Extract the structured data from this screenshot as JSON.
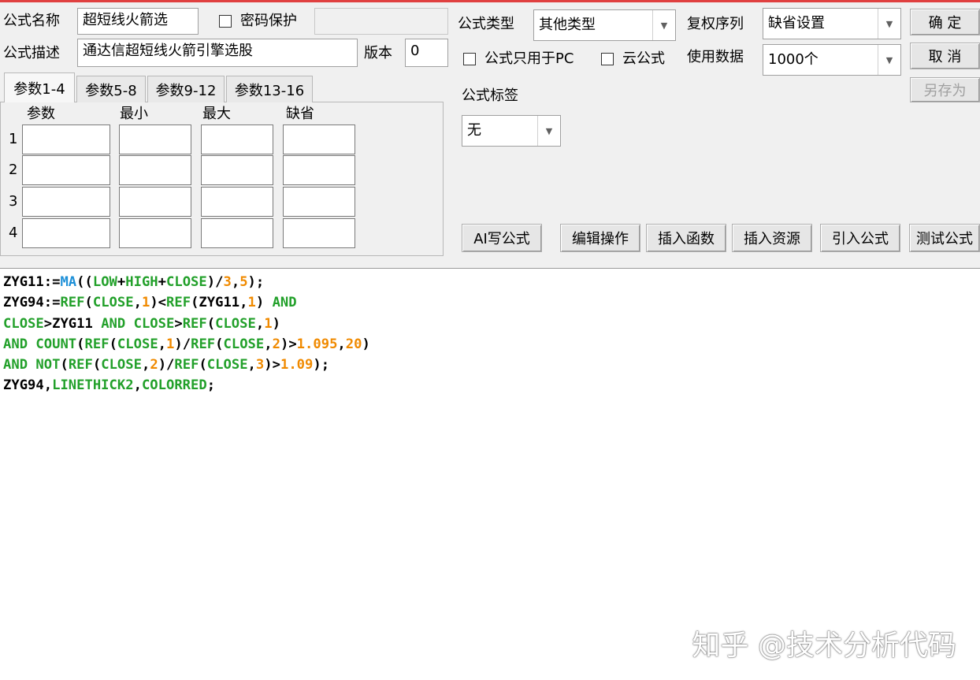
{
  "form": {
    "name_label": "公式名称",
    "name_value": "超短线火箭选",
    "password_label": "密码保护",
    "desc_label": "公式描述",
    "desc_value": "通达信超短线火箭引擎选股",
    "version_label": "版本",
    "version_value": "0"
  },
  "options": {
    "type_label": "公式类型",
    "type_value": "其他类型",
    "restore_label": "复权序列",
    "restore_value": "缺省设置",
    "pc_only_label": "公式只用于PC",
    "cloud_label": "云公式",
    "usedata_label": "使用数据",
    "usedata_value": "1000个",
    "tag_label": "公式标签",
    "tag_value": "无"
  },
  "buttons": {
    "ok": "确  定",
    "cancel": "取  消",
    "saveas": "另存为",
    "ai": "AI写公式",
    "edit": "编辑操作",
    "insert_func": "插入函数",
    "insert_res": "插入资源",
    "import": "引入公式",
    "test": "测试公式"
  },
  "params": {
    "tabs": [
      "参数1-4",
      "参数5-8",
      "参数9-12",
      "参数13-16"
    ],
    "headers": [
      "参数",
      "最小",
      "最大",
      "缺省"
    ],
    "rows": [
      "1",
      "2",
      "3",
      "4"
    ]
  },
  "code": {
    "lines": [
      [
        [
          "ZYG11:=",
          "k"
        ],
        [
          "MA",
          "m"
        ],
        [
          "((",
          "k"
        ],
        [
          "LOW",
          "f"
        ],
        [
          "+",
          "k"
        ],
        [
          "HIGH",
          "f"
        ],
        [
          "+",
          "k"
        ],
        [
          "CLOSE",
          "f"
        ],
        [
          ")/",
          "k"
        ],
        [
          "3",
          "n"
        ],
        [
          ",",
          "k"
        ],
        [
          "5",
          "n"
        ],
        [
          ");",
          "k"
        ]
      ],
      [
        [
          "ZYG94:=",
          "k"
        ],
        [
          "REF",
          "f"
        ],
        [
          "(",
          "k"
        ],
        [
          "CLOSE",
          "f"
        ],
        [
          ",",
          "k"
        ],
        [
          "1",
          "n"
        ],
        [
          ")<",
          "k"
        ],
        [
          "REF",
          "f"
        ],
        [
          "(ZYG11,",
          "k"
        ],
        [
          "1",
          "n"
        ],
        [
          ") ",
          "k"
        ],
        [
          "AND",
          "f"
        ]
      ],
      [
        [
          "CLOSE",
          "f"
        ],
        [
          ">ZYG11 ",
          "k"
        ],
        [
          "AND",
          "f"
        ],
        [
          " ",
          "k"
        ],
        [
          "CLOSE",
          "f"
        ],
        [
          ">",
          "k"
        ],
        [
          "REF",
          "f"
        ],
        [
          "(",
          "k"
        ],
        [
          "CLOSE",
          "f"
        ],
        [
          ",",
          "k"
        ],
        [
          "1",
          "n"
        ],
        [
          ")",
          "k"
        ]
      ],
      [
        [
          "AND",
          "f"
        ],
        [
          " ",
          "k"
        ],
        [
          "COUNT",
          "f"
        ],
        [
          "(",
          "k"
        ],
        [
          "REF",
          "f"
        ],
        [
          "(",
          "k"
        ],
        [
          "CLOSE",
          "f"
        ],
        [
          ",",
          "k"
        ],
        [
          "1",
          "n"
        ],
        [
          ")/",
          "k"
        ],
        [
          "REF",
          "f"
        ],
        [
          "(",
          "k"
        ],
        [
          "CLOSE",
          "f"
        ],
        [
          ",",
          "k"
        ],
        [
          "2",
          "n"
        ],
        [
          ")>",
          "k"
        ],
        [
          "1.095",
          "n"
        ],
        [
          ",",
          "k"
        ],
        [
          "20",
          "n"
        ],
        [
          ")",
          "k"
        ]
      ],
      [
        [
          "AND",
          "f"
        ],
        [
          " ",
          "k"
        ],
        [
          "NOT",
          "f"
        ],
        [
          "(",
          "k"
        ],
        [
          "REF",
          "f"
        ],
        [
          "(",
          "k"
        ],
        [
          "CLOSE",
          "f"
        ],
        [
          ",",
          "k"
        ],
        [
          "2",
          "n"
        ],
        [
          ")/",
          "k"
        ],
        [
          "REF",
          "f"
        ],
        [
          "(",
          "k"
        ],
        [
          "CLOSE",
          "f"
        ],
        [
          ",",
          "k"
        ],
        [
          "3",
          "n"
        ],
        [
          ")>",
          "k"
        ],
        [
          "1.09",
          "n"
        ],
        [
          ");",
          "k"
        ]
      ],
      [
        [
          "ZYG94,",
          "k"
        ],
        [
          "LINETHICK2",
          "f"
        ],
        [
          ",",
          "k"
        ],
        [
          "COLORRED",
          "f"
        ],
        [
          ";",
          "k"
        ]
      ]
    ]
  },
  "watermark": "知乎 @技术分析代码"
}
